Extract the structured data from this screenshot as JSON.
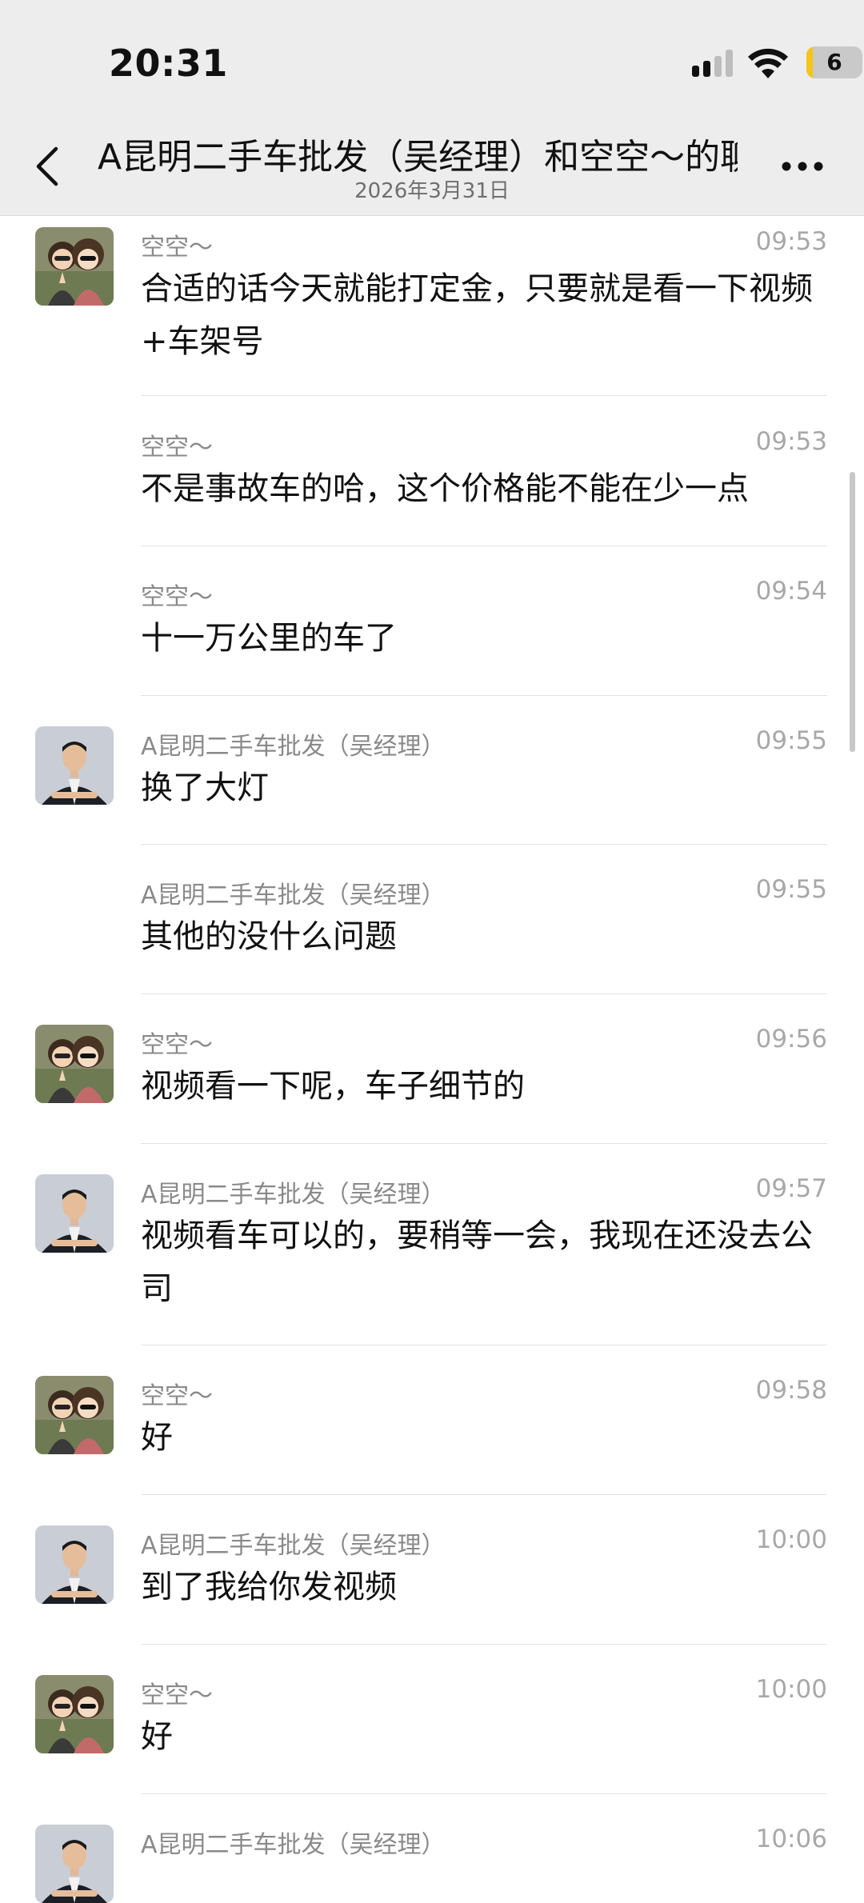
{
  "status_bar": {
    "time": "20:31",
    "battery": "6"
  },
  "header": {
    "title": "A昆明二手车批发（吴经理）和空空～的聊",
    "subtitle": "2026年3月31日"
  },
  "messages": [
    {
      "sender": "空空～",
      "time": "09:53",
      "text": "合适的话今天就能打定金，只要就是看一下视频+车架号"
    },
    {
      "sender": "空空～",
      "time": "09:53",
      "text": "不是事故车的哈，这个价格能不能在少一点"
    },
    {
      "sender": "空空～",
      "time": "09:54",
      "text": "十一万公里的车了"
    },
    {
      "sender": "A昆明二手车批发（吴经理）",
      "time": "09:55",
      "text": "换了大灯"
    },
    {
      "sender": "A昆明二手车批发（吴经理）",
      "time": "09:55",
      "text": "其他的没什么问题"
    },
    {
      "sender": "空空～",
      "time": "09:56",
      "text": "视频看一下呢，车子细节的"
    },
    {
      "sender": "A昆明二手车批发（吴经理）",
      "time": "09:57",
      "text": "视频看车可以的，要稍等一会，我现在还没去公司"
    },
    {
      "sender": "空空～",
      "time": "09:58",
      "text": "好"
    },
    {
      "sender": "A昆明二手车批发（吴经理）",
      "time": "10:00",
      "text": "到了我给你发视频"
    },
    {
      "sender": "空空～",
      "time": "10:00",
      "text": "好"
    },
    {
      "sender": "A昆明二手车批发（吴经理）",
      "time": "10:06",
      "text": ""
    }
  ]
}
